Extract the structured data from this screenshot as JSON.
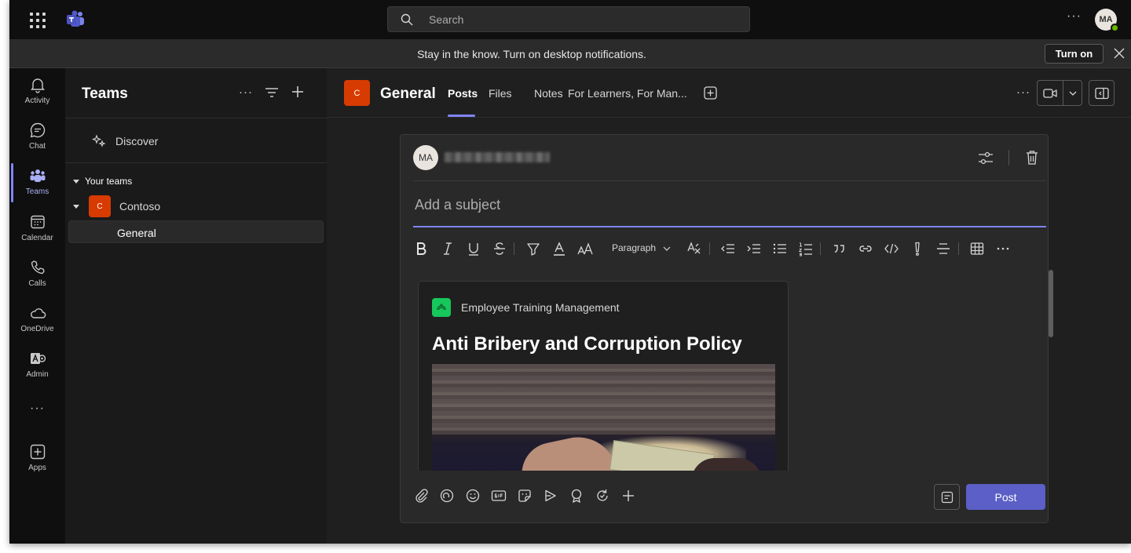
{
  "search": {
    "placeholder": "Search"
  },
  "titlebar": {
    "more": "···",
    "avatar_initials": "MA"
  },
  "notification": {
    "message": "Stay in the know. Turn on desktop notifications.",
    "button": "Turn on"
  },
  "rail": {
    "items": [
      {
        "label": "Activity",
        "icon": "bell-icon"
      },
      {
        "label": "Chat",
        "icon": "chat-icon"
      },
      {
        "label": "Teams",
        "icon": "teams-icon",
        "active": true
      },
      {
        "label": "Calendar",
        "icon": "calendar-icon"
      },
      {
        "label": "Calls",
        "icon": "phone-icon"
      },
      {
        "label": "OneDrive",
        "icon": "cloud-icon"
      },
      {
        "label": "Admin",
        "icon": "admin-icon"
      },
      {
        "label": "Apps",
        "icon": "add-app-icon"
      }
    ],
    "more": "···"
  },
  "teams_panel": {
    "title": "Teams",
    "more": "···",
    "discover": "Discover",
    "section": "Your teams",
    "team": {
      "name": "Contoso",
      "initial": "C",
      "color": "#d83b01"
    },
    "channel": "General"
  },
  "channel_header": {
    "initial": "C",
    "title": "General",
    "tabs": [
      "Posts",
      "Files",
      "Notes",
      "For Learners, For Man..."
    ],
    "active_tab": "Posts",
    "more": "···"
  },
  "compose": {
    "avatar_initials": "MA",
    "subject_placeholder": "Add a subject",
    "toolbar": {
      "paragraph": "Paragraph"
    },
    "card": {
      "app_name": "Employee Training Management",
      "title": "Anti Bribery and Corruption Policy"
    },
    "post_button": "Post"
  },
  "colors": {
    "accent": "#7f85f5",
    "post_button": "#5b5fc7",
    "team_avatar": "#d83b01",
    "app_icon": "#16c75b"
  }
}
